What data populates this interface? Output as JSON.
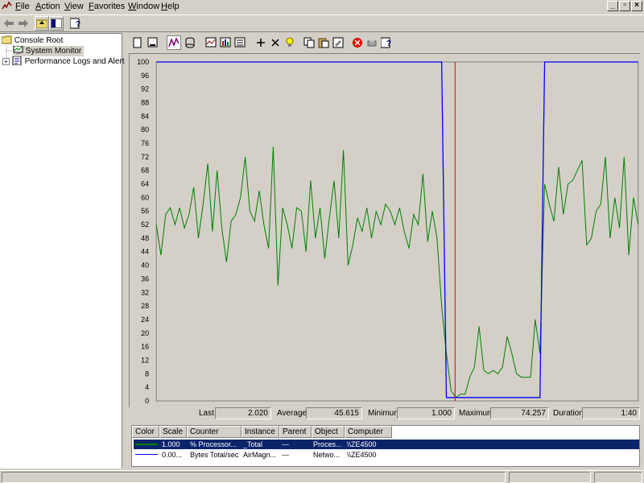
{
  "menu": [
    "File",
    "Action",
    "View",
    "Favorites",
    "Window",
    "Help"
  ],
  "tree": {
    "root": "Console Root",
    "system_monitor": "System Monitor",
    "perf_logs": "Performance Logs and Alerts"
  },
  "chart_data": {
    "type": "line",
    "ylim": [
      0,
      100
    ],
    "yticks": [
      "100",
      "96",
      "92",
      "88",
      "84",
      "80",
      "76",
      "72",
      "68",
      "64",
      "60",
      "56",
      "52",
      "48",
      "44",
      "40",
      "36",
      "32",
      "28",
      "24",
      "20",
      "16",
      "12",
      "8",
      "4",
      "0"
    ],
    "grid": false,
    "cursor_position": 0.62,
    "series": [
      {
        "color": "#008000",
        "values": [
          52,
          43,
          55,
          57,
          52,
          57,
          51,
          55,
          63,
          48,
          58,
          70,
          50,
          68,
          51,
          41,
          53,
          55,
          60,
          72,
          56,
          53,
          62,
          52,
          45,
          75,
          34,
          57,
          52,
          45,
          57,
          56,
          44,
          65,
          48,
          57,
          42,
          54,
          65,
          48,
          74,
          40,
          46,
          54,
          50,
          57,
          48,
          56,
          52,
          58,
          56,
          52,
          57,
          50,
          45,
          55,
          52,
          67,
          47,
          56,
          48,
          28,
          14,
          3,
          1,
          2,
          2,
          7,
          10,
          22,
          9,
          8,
          9,
          8,
          10,
          19,
          14,
          8,
          7,
          7,
          7,
          24,
          14,
          64,
          58,
          53,
          69,
          55,
          64,
          65,
          68,
          71,
          46,
          48,
          56,
          58,
          72,
          48,
          60,
          51,
          72,
          43,
          60,
          52
        ]
      },
      {
        "color": "#0000ff",
        "values": [
          100,
          100,
          100,
          100,
          100,
          100,
          100,
          100,
          100,
          100,
          100,
          100,
          100,
          100,
          100,
          100,
          100,
          100,
          100,
          100,
          100,
          100,
          100,
          100,
          100,
          100,
          100,
          100,
          100,
          100,
          100,
          100,
          100,
          100,
          100,
          100,
          100,
          100,
          100,
          100,
          100,
          100,
          100,
          100,
          100,
          100,
          100,
          100,
          100,
          100,
          100,
          100,
          100,
          100,
          100,
          100,
          100,
          100,
          100,
          100,
          100,
          100,
          1,
          1,
          1,
          1,
          1,
          1,
          1,
          1,
          1,
          1,
          1,
          1,
          1,
          1,
          1,
          1,
          1,
          1,
          1,
          1,
          1,
          100,
          100,
          100,
          100,
          100,
          100,
          100,
          100,
          100,
          100,
          100,
          100,
          100,
          100,
          100,
          100,
          100,
          100,
          100,
          100,
          100
        ]
      }
    ]
  },
  "stats": {
    "last_label": "Last",
    "last": "2.020",
    "avg_label": "Average",
    "avg": "45.615",
    "min_label": "Minimum",
    "min": "1.000",
    "max_label": "Maximum",
    "max": "74.257",
    "dur_label": "Duration",
    "dur": "1:40"
  },
  "legend": {
    "headers": [
      "Color",
      "Scale",
      "Counter",
      "Instance",
      "Parent",
      "Object",
      "Computer"
    ],
    "rows": [
      {
        "color": "#008000",
        "scale": "1.000",
        "counter": "% Processor...",
        "instance": "_Total",
        "parent": "---",
        "object": "Proces...",
        "computer": "\\\\ZE4500"
      },
      {
        "color": "#0000ff",
        "scale": "0.00...",
        "counter": "Bytes Total/sec",
        "instance": "AirMagn...",
        "parent": "---",
        "object": "Netwo...",
        "computer": "\\\\ZE4500"
      }
    ]
  }
}
